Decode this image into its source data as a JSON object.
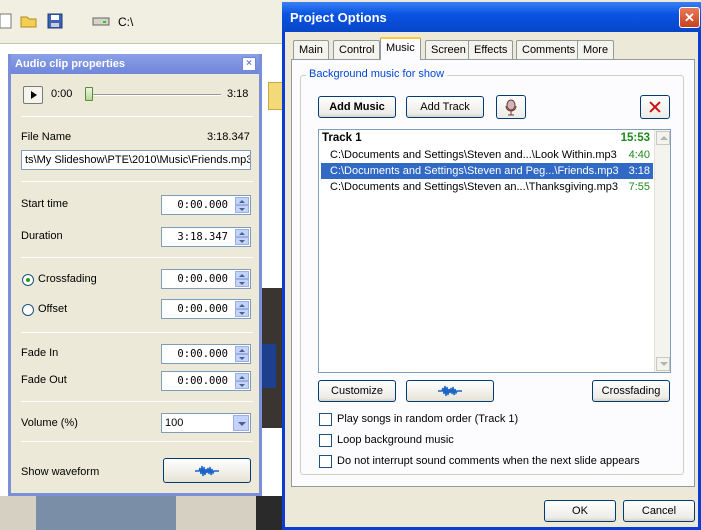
{
  "bg": {
    "path": "C:\\"
  },
  "audio_clip": {
    "title": "Audio clip properties",
    "close": "×",
    "time_start": "0:00",
    "time_end": "3:18",
    "position_fraction": 0.0,
    "file_name_label": "File Name",
    "file_duration": "3:18.347",
    "file_path": "ts\\My Slideshow\\PTE\\2010\\Music\\Friends.mp3",
    "start_time_label": "Start time",
    "start_time": "0:00.000",
    "duration_label": "Duration",
    "duration": "3:18.347",
    "crossfading_label": "Crossfading",
    "crossfading": "0:00.000",
    "offset_label": "Offset",
    "offset": "0:00.000",
    "fade_in_label": "Fade In",
    "fade_in": "0:00.000",
    "fade_out_label": "Fade Out",
    "fade_out": "0:00.000",
    "volume_label": "Volume (%)",
    "volume": "100",
    "waveform_label": "Show waveform"
  },
  "project_options": {
    "title": "Project Options",
    "close": "✕",
    "tabs": [
      "Main",
      "Control",
      "Music",
      "Screen",
      "Effects",
      "Comments",
      "More"
    ],
    "active_tab": "Music",
    "group_title": "Background music for show",
    "add_music": "Add Music",
    "add_track": "Add Track",
    "track": {
      "name": "Track 1",
      "total": "15:53",
      "items": [
        {
          "path": "C:\\Documents and Settings\\Steven and...\\Look Within.mp3",
          "duration": "4:40"
        },
        {
          "path": "C:\\Documents and Settings\\Steven and Peg...\\Friends.mp3",
          "duration": "3:18"
        },
        {
          "path": "C:\\Documents and Settings\\Steven an...\\Thanksgiving.mp3",
          "duration": "7:55"
        }
      ]
    },
    "customize": "Customize",
    "crossfading": "Crossfading",
    "options": [
      {
        "label": "Play songs in random order (Track 1)",
        "checked": false
      },
      {
        "label": "Loop background music",
        "checked": false
      },
      {
        "label": "Do not interrupt sound comments when the next slide appears",
        "checked": false
      }
    ],
    "ok": "OK",
    "cancel": "Cancel"
  }
}
